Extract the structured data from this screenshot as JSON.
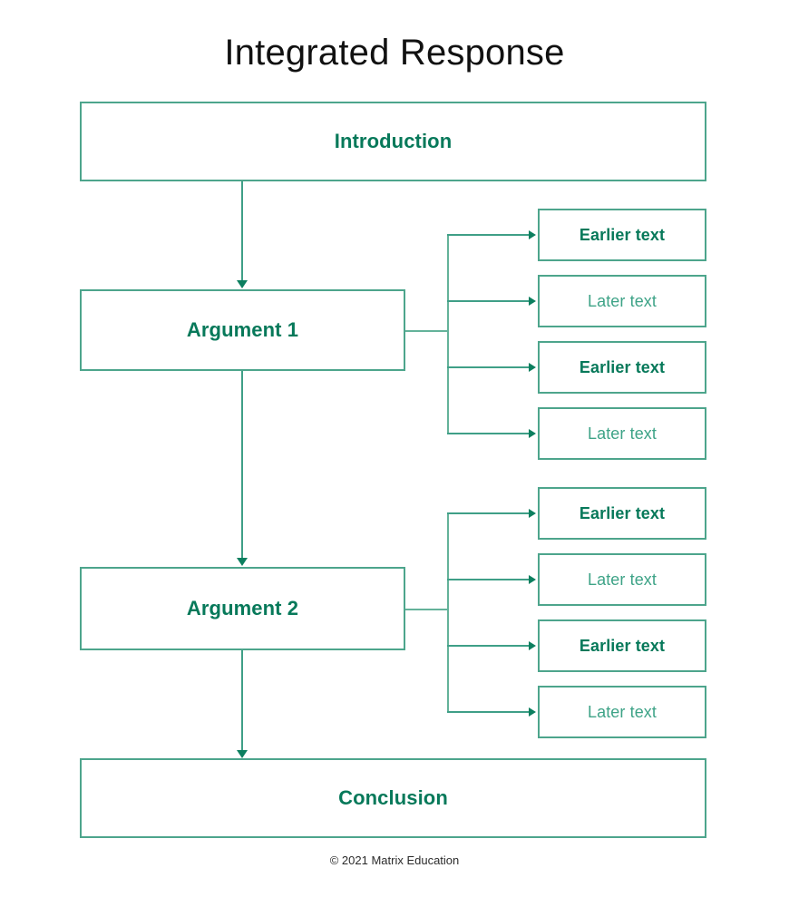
{
  "title": "Integrated Response",
  "footer": "© 2021 Matrix Education",
  "colors": {
    "accent_text": "#07795a",
    "muted_text": "#3ea387",
    "border": "#4da58c",
    "connector": "#3f9f87",
    "arrowhead": "#0c7f5f",
    "title_text": "#111111",
    "footer_text": "#2b2b2b",
    "background": "#ffffff"
  },
  "diagram": {
    "introduction": {
      "label": "Introduction"
    },
    "conclusion": {
      "label": "Conclusion"
    },
    "arguments": [
      {
        "label": "Argument 1",
        "evidence": [
          {
            "label": "Earlier text",
            "kind": "earlier"
          },
          {
            "label": "Later text",
            "kind": "later"
          },
          {
            "label": "Earlier text",
            "kind": "earlier"
          },
          {
            "label": "Later text",
            "kind": "later"
          }
        ]
      },
      {
        "label": "Argument 2",
        "evidence": [
          {
            "label": "Earlier text",
            "kind": "earlier"
          },
          {
            "label": "Later text",
            "kind": "later"
          },
          {
            "label": "Earlier text",
            "kind": "earlier"
          },
          {
            "label": "Later text",
            "kind": "later"
          }
        ]
      }
    ]
  }
}
